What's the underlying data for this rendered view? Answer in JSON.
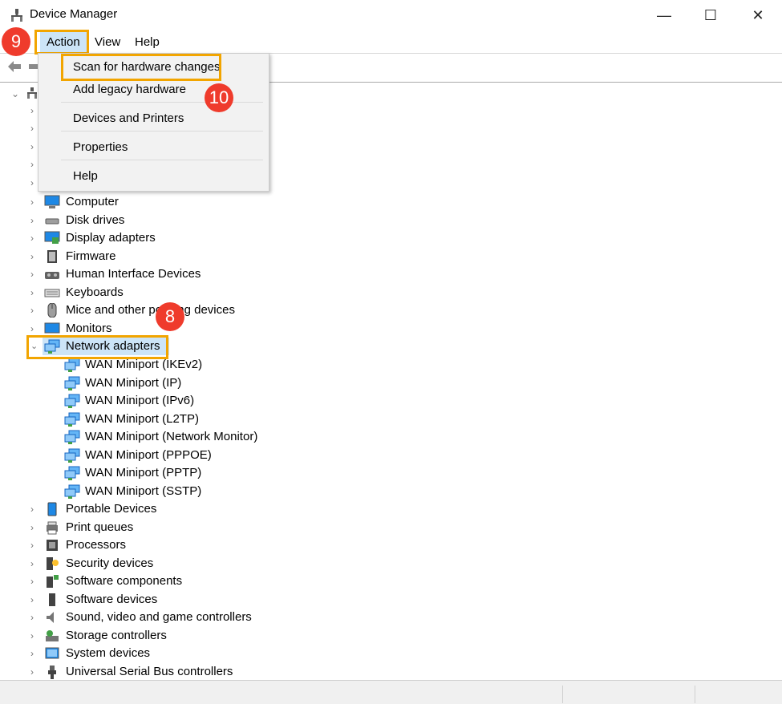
{
  "window": {
    "title": "Device Manager",
    "minimize": "—",
    "maximize": "☐",
    "close": "✕"
  },
  "menu": {
    "action": "Action",
    "view": "View",
    "help": "Help"
  },
  "action_menu": [
    "Scan for hardware changes",
    "Add legacy hardware",
    "Devices and Printers",
    "Properties",
    "Help"
  ],
  "badges": {
    "b9": "9",
    "b10": "10",
    "b8": "8"
  },
  "tree": {
    "categories_top": [
      "Computer",
      "Disk drives",
      "Display adapters",
      "Firmware",
      "Human Interface Devices",
      "Keyboards",
      "Mice and other pointing devices",
      "Monitors"
    ],
    "network": {
      "label": "Network adapters",
      "children": [
        "WAN Miniport (IKEv2)",
        "WAN Miniport (IP)",
        "WAN Miniport (IPv6)",
        "WAN Miniport (L2TP)",
        "WAN Miniport (Network Monitor)",
        "WAN Miniport (PPPOE)",
        "WAN Miniport (PPTP)",
        "WAN Miniport (SSTP)"
      ]
    },
    "categories_bottom": [
      "Portable Devices",
      "Print queues",
      "Processors",
      "Security devices",
      "Software components",
      "Software devices",
      "Sound, video and game controllers",
      "Storage controllers",
      "System devices",
      "Universal Serial Bus controllers"
    ]
  },
  "colors": {
    "highlight": "#f2a500",
    "badge": "#ef3b2c",
    "selection": "#cce4f7"
  }
}
